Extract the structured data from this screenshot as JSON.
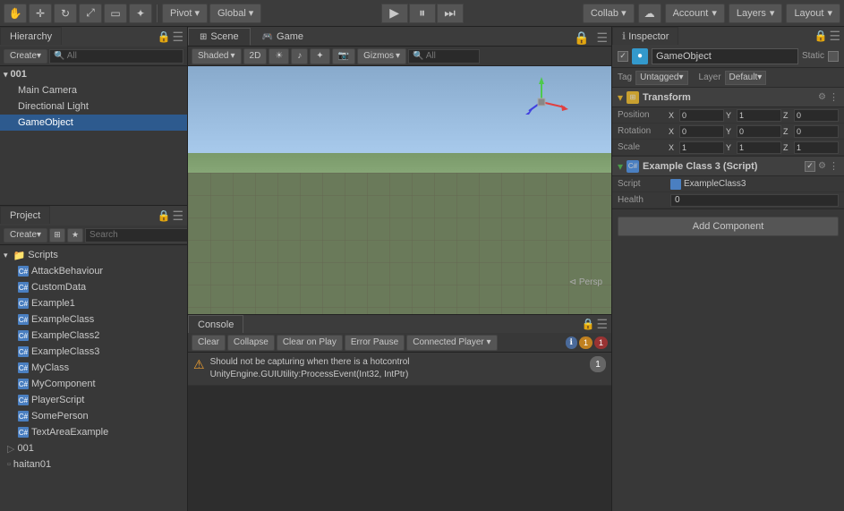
{
  "toolbar": {
    "hand_tool_label": "✋",
    "move_tool_label": "+",
    "rotate_tool_label": "↻",
    "scale_tool_label": "⤢",
    "rect_tool_label": "⊡",
    "transform_tool_label": "✦",
    "pivot_label": "Pivot",
    "global_label": "Global",
    "play_label": "▶",
    "pause_label": "⏸",
    "step_label": "⏭",
    "collab_label": "Collab ▾",
    "cloud_label": "☁",
    "account_label": "Account",
    "layers_label": "Layers",
    "layout_label": "Layout"
  },
  "hierarchy": {
    "title": "Hierarchy",
    "create_label": "Create",
    "all_label": "All",
    "scene_name": "001",
    "items": [
      {
        "label": "Main Camera",
        "indent": 1
      },
      {
        "label": "Directional Light",
        "indent": 1
      },
      {
        "label": "GameObject",
        "indent": 1,
        "selected": true
      }
    ]
  },
  "scene_view": {
    "title": "Scene",
    "shading_label": "Shaded",
    "mode_2d_label": "2D",
    "gizmos_label": "Gizmos",
    "all_label": "All",
    "persp_label": "⊲ Persp"
  },
  "game_view": {
    "title": "Game"
  },
  "console": {
    "title": "Console",
    "clear_label": "Clear",
    "collapse_label": "Collapse",
    "clear_on_play_label": "Clear on Play",
    "error_pause_label": "Error Pause",
    "connected_label": "Connected Player ▾",
    "entries": [
      {
        "icon": "⚠",
        "text_line1": "Should not be capturing when there is a hotcontrol",
        "text_line2": "UnityEngine.GUIUtility:ProcessEvent(Int32, IntPtr)",
        "count": "1"
      }
    ],
    "warn_count": "1",
    "error_count": "1"
  },
  "inspector": {
    "title": "Inspector",
    "gameobject_name": "GameObject",
    "static_label": "Static",
    "tag_label": "Tag",
    "tag_value": "Untagged",
    "layer_label": "Layer",
    "layer_value": "Default",
    "transform": {
      "title": "Transform",
      "position_label": "Position",
      "rotation_label": "Rotation",
      "scale_label": "Scale",
      "position": {
        "x": "0",
        "y": "1",
        "z": "0"
      },
      "rotation": {
        "x": "0",
        "y": "0",
        "z": "0"
      },
      "scale": {
        "x": "1",
        "y": "1",
        "z": "1"
      }
    },
    "script_component": {
      "title": "Example Class 3 (Script)",
      "script_label": "Script",
      "script_value": "ExampleClass3",
      "health_label": "Health",
      "health_value": "0"
    },
    "add_component_label": "Add Component"
  },
  "project": {
    "title": "Project",
    "create_label": "Create",
    "search_placeholder": "Search",
    "folders": [
      {
        "label": "Scripts",
        "indent": 0,
        "expanded": true
      },
      {
        "label": "AttackBehaviour",
        "indent": 1,
        "type": "script"
      },
      {
        "label": "CustomData",
        "indent": 1,
        "type": "script"
      },
      {
        "label": "Example1",
        "indent": 1,
        "type": "script"
      },
      {
        "label": "ExampleClass",
        "indent": 1,
        "type": "script"
      },
      {
        "label": "ExampleClass2",
        "indent": 1,
        "type": "script"
      },
      {
        "label": "ExampleClass3",
        "indent": 1,
        "type": "script"
      },
      {
        "label": "MyClass",
        "indent": 1,
        "type": "script"
      },
      {
        "label": "MyComponent",
        "indent": 1,
        "type": "script"
      },
      {
        "label": "PlayerScript",
        "indent": 1,
        "type": "script"
      },
      {
        "label": "SomePerson",
        "indent": 1,
        "type": "script"
      },
      {
        "label": "TextAreaExample",
        "indent": 1,
        "type": "script"
      }
    ],
    "bottom_items": [
      {
        "label": "001",
        "type": "scene"
      },
      {
        "label": "haitan01",
        "type": "item"
      }
    ]
  }
}
